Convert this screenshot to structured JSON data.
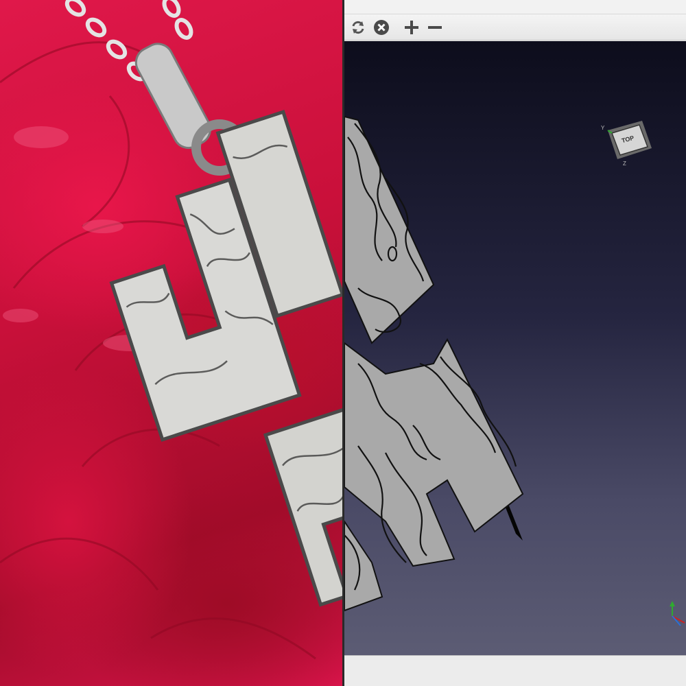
{
  "photo": {
    "subject": "pendant",
    "background": "red rose"
  },
  "cad": {
    "toolbar": {
      "buttons": [
        {
          "id": "refresh",
          "icon": "refresh-icon"
        },
        {
          "id": "stop",
          "icon": "stop-icon"
        },
        {
          "id": "zoom_in",
          "icon": "zoom-in-icon"
        },
        {
          "id": "zoom_out",
          "icon": "zoom-out-icon"
        }
      ]
    },
    "view_cube": {
      "face_label": "TOP",
      "axis_y": "Y",
      "axis_z": "Z"
    },
    "status": {
      "text": ""
    }
  },
  "colors": {
    "rose": "#d8144a",
    "model_face": "#a9a9a9",
    "viewport_top": "#0d0d1c",
    "viewport_bottom": "#5c5c74"
  }
}
